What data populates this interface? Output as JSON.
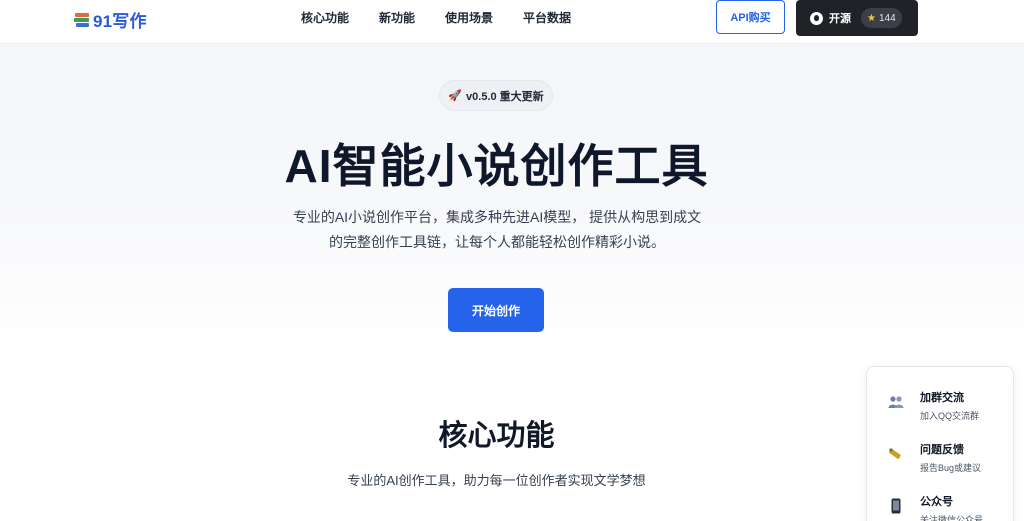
{
  "header": {
    "logo_text": "91写作",
    "nav": [
      "核心功能",
      "新功能",
      "使用场景",
      "平台数据"
    ],
    "api_button": "API购买",
    "github_button": "开源",
    "star_count": "144"
  },
  "hero": {
    "version_badge": "v0.5.0 重大更新",
    "title": "AI智能小说创作工具",
    "subtitle_line1": "专业的AI小说创作平台，集成多种先进AI模型， 提供从构思到成文",
    "subtitle_line2": "的完整创作工具链，让每个人都能轻松创作精彩小说。",
    "cta": "开始创作"
  },
  "features": {
    "title": "核心功能",
    "subtitle": "专业的AI创作工具，助力每一位创作者实现文学梦想"
  },
  "float_panel": {
    "items": [
      {
        "icon": "people-icon",
        "title": "加群交流",
        "desc": "加入QQ交流群"
      },
      {
        "icon": "feedback-icon",
        "title": "问题反馈",
        "desc": "报告Bug或建议"
      },
      {
        "icon": "phone-icon",
        "title": "公众号",
        "desc": "关注微信公众号"
      }
    ]
  },
  "colors": {
    "accent": "#2563eb",
    "dark_button": "#1f2328"
  }
}
